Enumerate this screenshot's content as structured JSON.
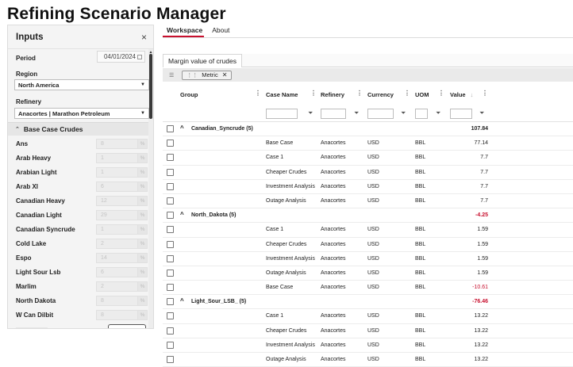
{
  "app": {
    "title": "Refining Scenario Manager"
  },
  "inputs_panel": {
    "title": "Inputs",
    "close_icon": "×",
    "period_label": "Period",
    "period_value": "04/01/2024",
    "region_label": "Region",
    "region_value": "North America",
    "refinery_label": "Refinery",
    "refinery_value": "Anacortes | Marathon Petroleum",
    "section_title": "Base Case Crudes",
    "crudes": [
      {
        "name": "Ans",
        "value": "8",
        "unit": "%"
      },
      {
        "name": "Arab Heavy",
        "value": "1",
        "unit": "%"
      },
      {
        "name": "Arabian Light",
        "value": "1",
        "unit": "%"
      },
      {
        "name": "Arab Xl",
        "value": "6",
        "unit": "%"
      },
      {
        "name": "Canadian Heavy",
        "value": "12",
        "unit": "%"
      },
      {
        "name": "Canadian Light",
        "value": "29",
        "unit": "%"
      },
      {
        "name": "Canadian Syncrude",
        "value": "1",
        "unit": "%"
      },
      {
        "name": "Cold Lake",
        "value": "2",
        "unit": "%"
      },
      {
        "name": "Espo",
        "value": "14",
        "unit": "%"
      },
      {
        "name": "Light Sour Lsb",
        "value": "6",
        "unit": "%"
      },
      {
        "name": "Marlim",
        "value": "2",
        "unit": "%"
      },
      {
        "name": "North Dakota",
        "value": "8",
        "unit": "%"
      },
      {
        "name": "W Can Dilbit",
        "value": "8",
        "unit": "%"
      }
    ]
  },
  "tabs": [
    {
      "label": "Workspace",
      "active": true
    },
    {
      "label": "About",
      "active": false
    }
  ],
  "panel": {
    "tab_label": "Margin value of crudes",
    "group_chip": "Metric",
    "chip_close": "✕"
  },
  "grid": {
    "columns": [
      "Group",
      "Case Name",
      "Refinery",
      "Currency",
      "UOM",
      "Value"
    ],
    "rows": [
      {
        "type": "group",
        "group": "Canadian_Syncrude (5)",
        "value": "107.84",
        "negative": false
      },
      {
        "type": "data",
        "case": "Base Case",
        "refinery": "Anacortes",
        "currency": "USD",
        "uom": "BBL",
        "value": "77.14",
        "negative": false
      },
      {
        "type": "data",
        "case": "Case 1",
        "refinery": "Anacortes",
        "currency": "USD",
        "uom": "BBL",
        "value": "7.7",
        "negative": false
      },
      {
        "type": "data",
        "case": "Cheaper Crudes",
        "refinery": "Anacortes",
        "currency": "USD",
        "uom": "BBL",
        "value": "7.7",
        "negative": false
      },
      {
        "type": "data",
        "case": "Investment Analysis",
        "refinery": "Anacortes",
        "currency": "USD",
        "uom": "BBL",
        "value": "7.7",
        "negative": false
      },
      {
        "type": "data",
        "case": "Outage Analysis",
        "refinery": "Anacortes",
        "currency": "USD",
        "uom": "BBL",
        "value": "7.7",
        "negative": false
      },
      {
        "type": "group",
        "group": "North_Dakota (5)",
        "value": "-4.25",
        "negative": true
      },
      {
        "type": "data",
        "case": "Case 1",
        "refinery": "Anacortes",
        "currency": "USD",
        "uom": "BBL",
        "value": "1.59",
        "negative": false
      },
      {
        "type": "data",
        "case": "Cheaper Crudes",
        "refinery": "Anacortes",
        "currency": "USD",
        "uom": "BBL",
        "value": "1.59",
        "negative": false
      },
      {
        "type": "data",
        "case": "Investment Analysis",
        "refinery": "Anacortes",
        "currency": "USD",
        "uom": "BBL",
        "value": "1.59",
        "negative": false
      },
      {
        "type": "data",
        "case": "Outage Analysis",
        "refinery": "Anacortes",
        "currency": "USD",
        "uom": "BBL",
        "value": "1.59",
        "negative": false
      },
      {
        "type": "data",
        "case": "Base Case",
        "refinery": "Anacortes",
        "currency": "USD",
        "uom": "BBL",
        "value": "-10.61",
        "negative": true
      },
      {
        "type": "group",
        "group": "Light_Sour_LSB_ (5)",
        "value": "-76.46",
        "negative": true
      },
      {
        "type": "data",
        "case": "Case 1",
        "refinery": "Anacortes",
        "currency": "USD",
        "uom": "BBL",
        "value": "13.22",
        "negative": false
      },
      {
        "type": "data",
        "case": "Cheaper Crudes",
        "refinery": "Anacortes",
        "currency": "USD",
        "uom": "BBL",
        "value": "13.22",
        "negative": false
      },
      {
        "type": "data",
        "case": "Investment Analysis",
        "refinery": "Anacortes",
        "currency": "USD",
        "uom": "BBL",
        "value": "13.22",
        "negative": false
      },
      {
        "type": "data",
        "case": "Outage Analysis",
        "refinery": "Anacortes",
        "currency": "USD",
        "uom": "BBL",
        "value": "13.22",
        "negative": false
      }
    ]
  }
}
